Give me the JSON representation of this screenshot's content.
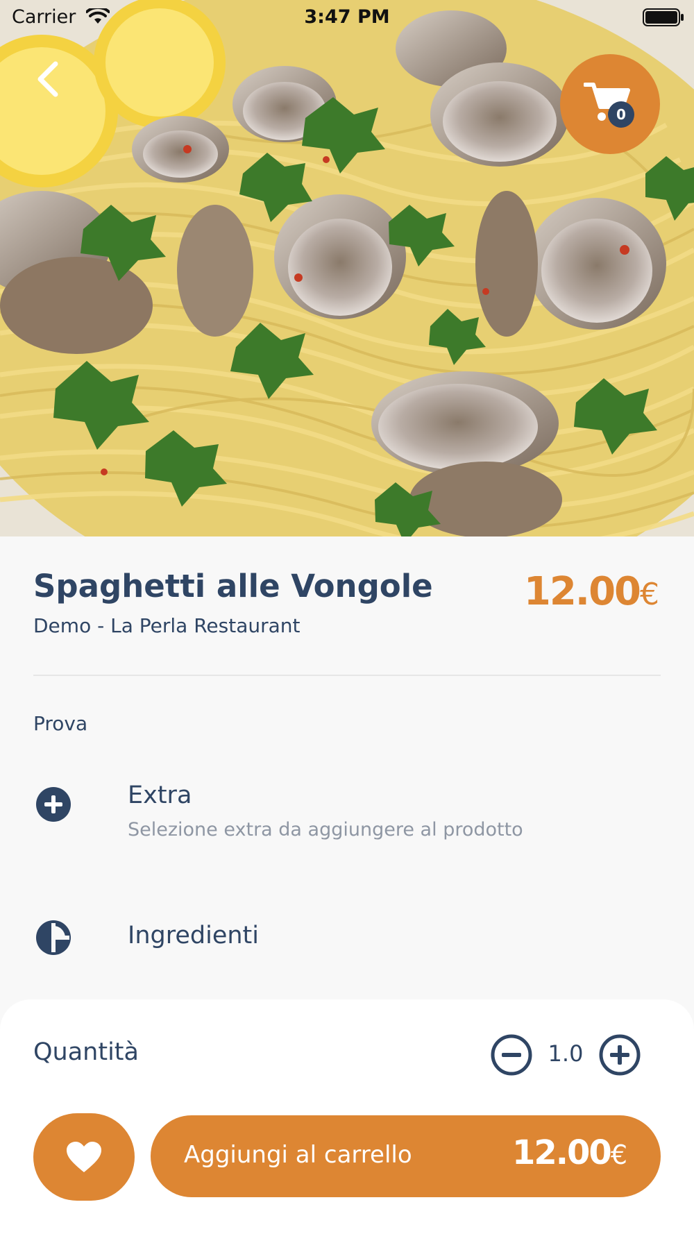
{
  "status_bar": {
    "carrier": "Carrier",
    "time": "3:47 PM"
  },
  "hero": {
    "image_subject": "spaghetti with clams, parsley and lemon"
  },
  "cart": {
    "icon": "cart-icon",
    "badge_count": "0"
  },
  "product": {
    "title": "Spaghetti alle Vongole",
    "restaurant": "Demo - La Perla Restaurant",
    "price_value": "12.00",
    "currency": "€",
    "description": "Prova"
  },
  "options": [
    {
      "icon": "plus-circle-icon",
      "title": "Extra",
      "subtitle": "Selezione extra da aggiungere al prodotto"
    },
    {
      "icon": "pie-chart-icon",
      "title": "Ingredienti"
    }
  ],
  "quantity": {
    "label": "Quantità",
    "value": "1.0"
  },
  "actions": {
    "favorite_icon": "heart-icon",
    "add_to_cart_label": "Aggiungi al carrello",
    "total_value": "12.00",
    "currency": "€"
  },
  "colors": {
    "accent": "#dd8633",
    "primary_text": "#2f4564",
    "secondary_text": "#8e96a3",
    "background": "#f8f8f8"
  }
}
